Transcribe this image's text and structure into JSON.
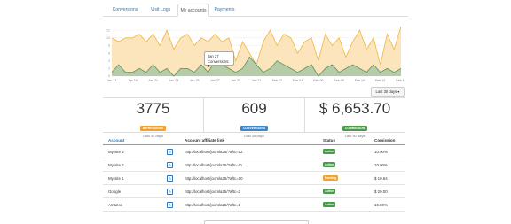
{
  "tabs": [
    {
      "label": "Conversions",
      "active": false
    },
    {
      "label": "Visit Logs",
      "active": false
    },
    {
      "label": "My accounts",
      "active": true
    },
    {
      "label": "Payments",
      "active": false
    }
  ],
  "chart_data": {
    "type": "area",
    "x_labels": [
      "Jan 17",
      "Jan 19",
      "Jan 21",
      "Jan 23",
      "Jan 25",
      "Jan 27",
      "Jan 29",
      "Jan 31",
      "Feb 02",
      "Feb 04",
      "Feb 06",
      "Feb 08",
      "Feb 10",
      "Feb 12",
      "Feb 14"
    ],
    "y_ticks": [
      0,
      2,
      4,
      6,
      8,
      10,
      12
    ],
    "ylim": [
      0,
      12.5
    ],
    "series": [
      {
        "values": [
          10,
          9,
          10,
          10,
          11,
          9,
          11,
          8,
          12,
          7,
          10,
          11,
          8,
          10,
          9,
          11,
          9,
          10,
          4,
          9,
          6,
          3,
          9,
          12,
          8,
          11,
          10,
          6,
          9,
          10,
          4,
          11,
          8,
          10,
          5,
          9,
          12,
          7,
          10,
          3,
          11,
          7,
          13
        ],
        "color": "#f0b541",
        "fill": "#fbe1b0"
      },
      {
        "values": [
          1,
          3,
          1,
          1,
          2,
          1,
          3,
          1,
          2,
          0,
          2,
          2,
          1,
          3,
          1,
          4,
          3,
          2,
          1,
          2,
          5,
          3,
          1,
          2,
          4,
          3,
          2,
          1,
          2,
          3,
          0,
          2,
          3,
          1,
          2,
          3,
          2,
          1,
          3,
          1,
          2,
          1,
          2
        ],
        "color": "#5f8f5c",
        "fill": "#a9c8a5"
      }
    ],
    "tooltip": {
      "title": "Jan 27",
      "text": "Conversions: 3",
      "index": 15
    }
  },
  "range_button": "Last 30 days ▾",
  "stats": [
    {
      "value": "3775",
      "badge": "IMPRESSIONS",
      "badge_color": "#f0a02c",
      "sub": "Last 30 days"
    },
    {
      "value": "609",
      "badge": "CONVERSIONS",
      "badge_color": "#3a87c9",
      "sub": "Last 30 days"
    },
    {
      "value": "$ 6,653.70",
      "badge": "COMMISSION",
      "badge_color": "#4a9a4a",
      "sub": "Last 30 days"
    }
  ],
  "table": {
    "headers": {
      "account": "Account",
      "link": "Account affiliate link",
      "status": "Status",
      "commission": "Comission"
    },
    "rows": [
      {
        "account": "My site 3",
        "link": "http://localhost/joomla25/?aftc=12",
        "status": "Active",
        "status_color": "#4a9a4a",
        "commission": "10.00%"
      },
      {
        "account": "My site 2",
        "link": "http://localhost/joomla25/?aftc=11",
        "status": "Active",
        "status_color": "#4a9a4a",
        "commission": "10.00%"
      },
      {
        "account": "My site 1",
        "link": "http://localhost/joomla25/?aftc=10",
        "status": "Pending",
        "status_color": "#f0a02c",
        "commission": "$ 10.64"
      },
      {
        "account": "Google",
        "link": "http://localhost/joomla25/?aftc=2",
        "status": "Active",
        "status_color": "#4a9a4a",
        "commission": "$ 20.00"
      },
      {
        "account": "Amazon",
        "link": "http://localhost/joomla25/?aftc=1",
        "status": "Active",
        "status_color": "#4a9a4a",
        "commission": "10.00%"
      }
    ]
  }
}
